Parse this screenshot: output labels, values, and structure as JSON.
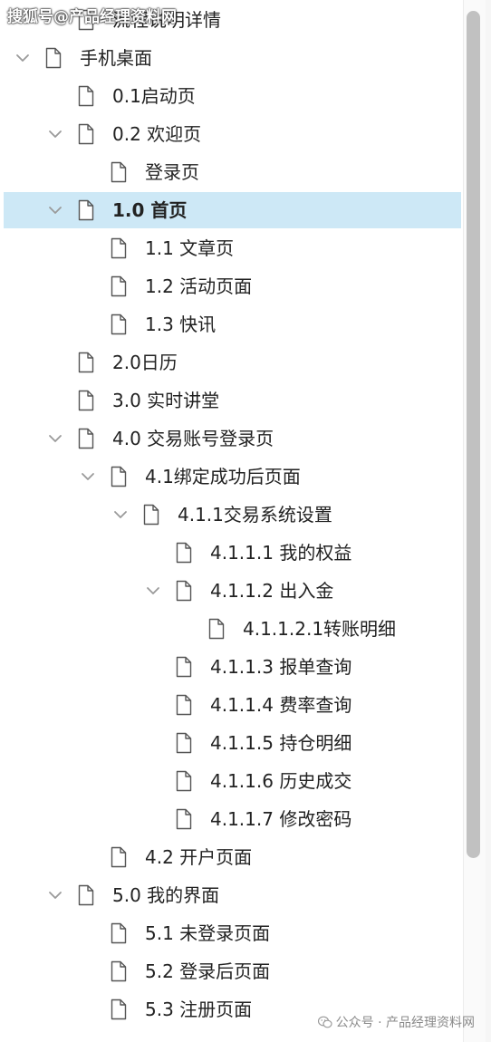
{
  "tree": {
    "rows": [
      {
        "label": "流程说明详情",
        "indent": 1,
        "chevron": "none",
        "selected": false
      },
      {
        "label": "手机桌面",
        "indent": 0,
        "chevron": "down",
        "selected": false
      },
      {
        "label": "0.1启动页",
        "indent": 1,
        "chevron": "none",
        "selected": false
      },
      {
        "label": "0.2 欢迎页",
        "indent": 1,
        "chevron": "down",
        "selected": false
      },
      {
        "label": "登录页",
        "indent": 2,
        "chevron": "none",
        "selected": false
      },
      {
        "label": "1.0 首页",
        "indent": 1,
        "chevron": "down",
        "selected": true
      },
      {
        "label": "1.1 文章页",
        "indent": 2,
        "chevron": "none",
        "selected": false
      },
      {
        "label": "1.2 活动页面",
        "indent": 2,
        "chevron": "none",
        "selected": false
      },
      {
        "label": "1.3 快讯",
        "indent": 2,
        "chevron": "none",
        "selected": false
      },
      {
        "label": "2.0日历",
        "indent": 1,
        "chevron": "none",
        "selected": false
      },
      {
        "label": "3.0 实时讲堂",
        "indent": 1,
        "chevron": "none",
        "selected": false
      },
      {
        "label": "4.0 交易账号登录页",
        "indent": 1,
        "chevron": "down",
        "selected": false
      },
      {
        "label": "4.1绑定成功后页面",
        "indent": 2,
        "chevron": "down",
        "selected": false
      },
      {
        "label": "4.1.1交易系统设置",
        "indent": 3,
        "chevron": "down",
        "selected": false
      },
      {
        "label": "4.1.1.1 我的权益",
        "indent": 4,
        "chevron": "none",
        "selected": false
      },
      {
        "label": "4.1.1.2 出入金",
        "indent": 4,
        "chevron": "down",
        "selected": false
      },
      {
        "label": "4.1.1.2.1转账明细",
        "indent": 5,
        "chevron": "none",
        "selected": false
      },
      {
        "label": "4.1.1.3 报单查询",
        "indent": 4,
        "chevron": "none",
        "selected": false
      },
      {
        "label": "4.1.1.4 费率查询",
        "indent": 4,
        "chevron": "none",
        "selected": false
      },
      {
        "label": "4.1.1.5 持仓明细",
        "indent": 4,
        "chevron": "none",
        "selected": false
      },
      {
        "label": "4.1.1.6 历史成交",
        "indent": 4,
        "chevron": "none",
        "selected": false
      },
      {
        "label": "4.1.1.7 修改密码",
        "indent": 4,
        "chevron": "none",
        "selected": false
      },
      {
        "label": "4.2 开户页面",
        "indent": 2,
        "chevron": "none",
        "selected": false
      },
      {
        "label": "5.0 我的界面",
        "indent": 1,
        "chevron": "down",
        "selected": false
      },
      {
        "label": "5.1 未登录页面",
        "indent": 2,
        "chevron": "none",
        "selected": false
      },
      {
        "label": "5.2 登录后页面",
        "indent": 2,
        "chevron": "none",
        "selected": false
      },
      {
        "label": "5.3 注册页面",
        "indent": 2,
        "chevron": "none",
        "selected": false
      }
    ]
  },
  "watermarks": {
    "top": "搜狐号@产品经理资料网",
    "bottom": "公众号 · 产品经理资料网"
  },
  "colors": {
    "selected_row": "#cde8f6",
    "chevron": "#9a9a9a",
    "doc_icon": "#555555",
    "scroll_thumb": "#c1c1c1"
  }
}
